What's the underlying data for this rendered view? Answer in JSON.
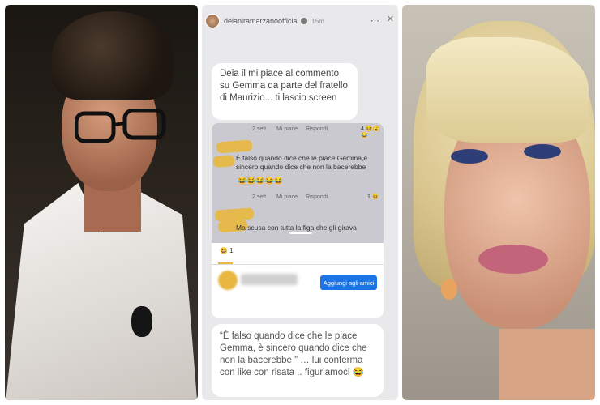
{
  "story": {
    "username": "deianiramarzanoofficial",
    "time": "15m",
    "more_icon": "⋯",
    "close_icon": "×",
    "top_caption": "Deia il mi piace al commento su Gemma da parte del fratello di Maurizio... ti lascio screen",
    "bottom_caption": "“È falso quando dice che le piace Gemma, è sincero quando dice che non la bacerebbe ” … lui conferma con like con risata .. figuriamoci 😂"
  },
  "screenshot": {
    "comment1": {
      "meta_time": "2 sett",
      "meta_like": "Mi piace",
      "meta_reply": "Rispondi",
      "reactions": "4 😆😮😂",
      "text": "È falso quando dice che le piace Gemma,è sincero quando dice che non la bacerebbe",
      "emojis": "😂😂😂😂😂"
    },
    "comment2": {
      "meta_time": "2 sett",
      "meta_like": "Mi piace",
      "meta_reply": "Rispondi",
      "reactions": "1 😆",
      "text": "Ma scusa con tutta la figa che gli girava"
    },
    "reaction_count": "😆 1",
    "add_friend_label": "Aggiungi agli amici"
  },
  "colors": {
    "accent": "#1b74e4",
    "scribble": "#e7b740",
    "story_bg": "#e9e9ec"
  }
}
